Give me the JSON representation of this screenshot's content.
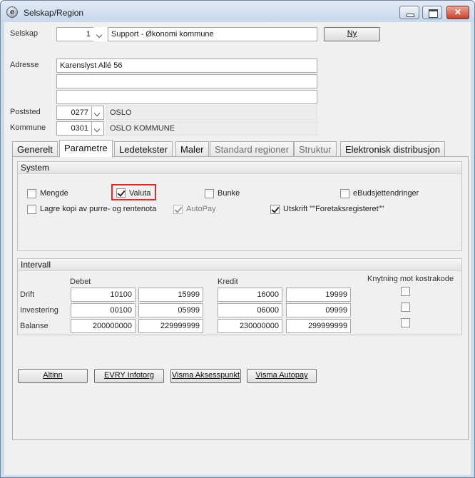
{
  "window": {
    "title": "Selskap/Region",
    "app_icon_glyph": "e"
  },
  "header": {
    "selskap_label": "Selskap",
    "selskap_number": "1",
    "selskap_name": "Support - Økonomi kommune",
    "ny_button": "Ny",
    "adresse_label": "Adresse",
    "adresse_line1": "Karenslyst Allé 56",
    "adresse_line2": "",
    "adresse_line3": "",
    "poststed_label": "Poststed",
    "poststed_code": "0277",
    "poststed_name": "OSLO",
    "kommune_label": "Kommune",
    "kommune_code": "0301",
    "kommune_name": "OSLO KOMMUNE"
  },
  "tabs": [
    {
      "label": "Generelt",
      "state": "normal"
    },
    {
      "label": "Parametre",
      "state": "active"
    },
    {
      "label": "Ledetekster",
      "state": "normal"
    },
    {
      "label": "Maler",
      "state": "normal"
    },
    {
      "label": "Standard regioner",
      "state": "disabled"
    },
    {
      "label": "Struktur",
      "state": "disabled"
    },
    {
      "label": "Elektronisk distribusjon",
      "state": "normal"
    }
  ],
  "system": {
    "title": "System",
    "checkboxes": [
      {
        "label": "Mengde",
        "checked": false,
        "enabled": true
      },
      {
        "label": "Valuta",
        "checked": true,
        "enabled": true,
        "highlighted": true
      },
      {
        "label": "Bunke",
        "checked": false,
        "enabled": true
      },
      {
        "label": "eBudsjettendringer",
        "checked": false,
        "enabled": true
      },
      {
        "label": "Lagre kopi av purre- og rentenota",
        "checked": false,
        "enabled": true
      },
      {
        "label": "AutoPay",
        "checked": true,
        "enabled": false
      },
      {
        "label": "Utskrift \"\"Foretaksregisteret\"\"",
        "checked": true,
        "enabled": true
      }
    ]
  },
  "intervall": {
    "title": "Intervall",
    "debet_label": "Debet",
    "kredit_label": "Kredit",
    "knytning_label": "Knytning mot kostrakode",
    "rows": [
      {
        "label": "Drift",
        "debet_from": "10100",
        "debet_to": "15999",
        "kredit_from": "16000",
        "kredit_to": "19999",
        "knytning": false
      },
      {
        "label": "Investering",
        "debet_from": "00100",
        "debet_to": "05999",
        "kredit_from": "06000",
        "kredit_to": "09999",
        "knytning": false
      },
      {
        "label": "Balanse",
        "debet_from": "200000000",
        "debet_to": "229999999",
        "kredit_from": "230000000",
        "kredit_to": "299999999",
        "knytning": false
      }
    ]
  },
  "bottom_buttons": [
    "Altinn",
    "EVRY Infotorg",
    "Visma Aksesspunkt",
    "Visma Autopay"
  ],
  "colors": {
    "highlight": "#e02a2a",
    "window_frame": "#cfdcec",
    "close_button": "#c8422d"
  }
}
